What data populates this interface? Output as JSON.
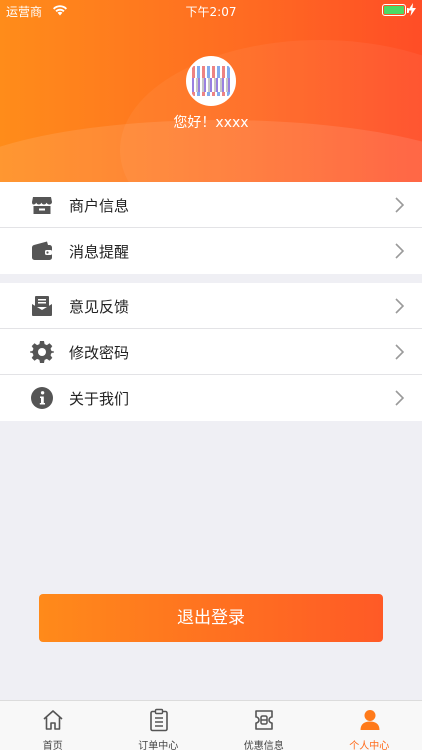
{
  "status_bar": {
    "carrier": "运营商",
    "time": "下午2:07"
  },
  "profile": {
    "greeting": "您好！xxxx"
  },
  "menu_group_1": [
    {
      "label": "商户信息",
      "icon": "store-icon"
    },
    {
      "label": "消息提醒",
      "icon": "wallet-icon"
    }
  ],
  "menu_group_2": [
    {
      "label": "意见反馈",
      "icon": "feedback-mail-icon"
    },
    {
      "label": "修改密码",
      "icon": "gear-icon"
    },
    {
      "label": "关于我们",
      "icon": "info-icon"
    }
  ],
  "logout_label": "退出登录",
  "tabs": [
    {
      "label": "首页",
      "icon": "home-icon",
      "active": false
    },
    {
      "label": "订单中心",
      "icon": "clipboard-icon",
      "active": false
    },
    {
      "label": "优惠信息",
      "icon": "coupon-icon",
      "active": false
    },
    {
      "label": "个人中心",
      "icon": "person-icon",
      "active": true
    }
  ],
  "colors": {
    "accent": "#ff6a1a",
    "icon_gray": "#555555",
    "battery_green": "#4cd964"
  }
}
